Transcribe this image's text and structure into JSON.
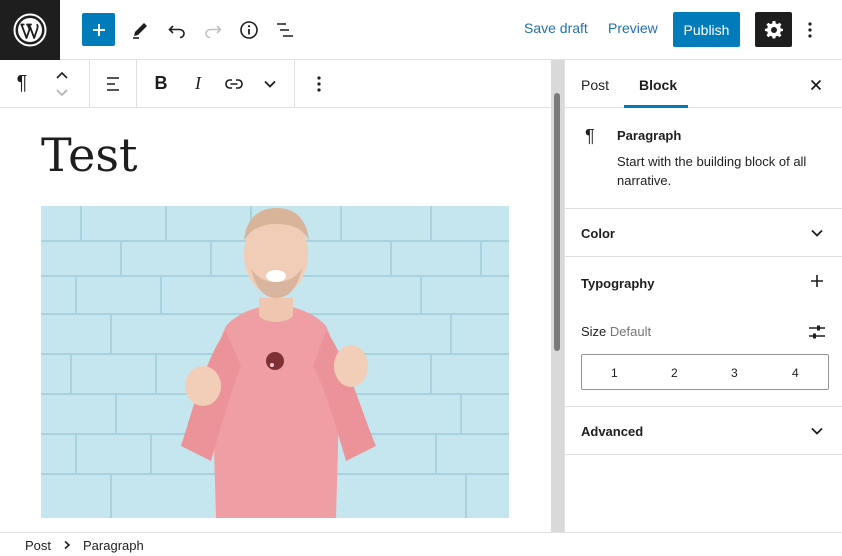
{
  "topbar": {
    "save_draft_label": "Save draft",
    "preview_label": "Preview",
    "publish_label": "Publish",
    "icons": [
      "wordpress-logo",
      "plus-icon",
      "pencil-icon",
      "undo-icon",
      "redo-icon",
      "info-icon",
      "list-view-icon",
      "gear-icon",
      "more-vertical-icon"
    ]
  },
  "block_toolbar": {
    "icons": [
      "paragraph-icon",
      "move-up-down-icon",
      "align-left-icon",
      "bold-icon",
      "italic-icon",
      "link-icon",
      "chevron-down-icon",
      "more-vertical-icon"
    ]
  },
  "editor": {
    "title": "Test",
    "image_subject": "laughing-man-red-sweater-blue-brick-wall"
  },
  "sidebar": {
    "tabs": [
      {
        "label": "Post"
      },
      {
        "label": "Block",
        "active": true
      }
    ],
    "block": {
      "name": "Paragraph",
      "description": "Start with the building block of all narrative."
    },
    "panels": {
      "color": "Color",
      "typography": "Typography",
      "advanced": "Advanced"
    },
    "size": {
      "label": "Size",
      "value": "Default",
      "options": [
        "1",
        "2",
        "3",
        "4"
      ]
    }
  },
  "breadcrumb": {
    "items": [
      "Post",
      "Paragraph"
    ]
  },
  "colors": {
    "accent": "#007cba",
    "dark": "#1e1e1e",
    "link": "#2271b1"
  }
}
